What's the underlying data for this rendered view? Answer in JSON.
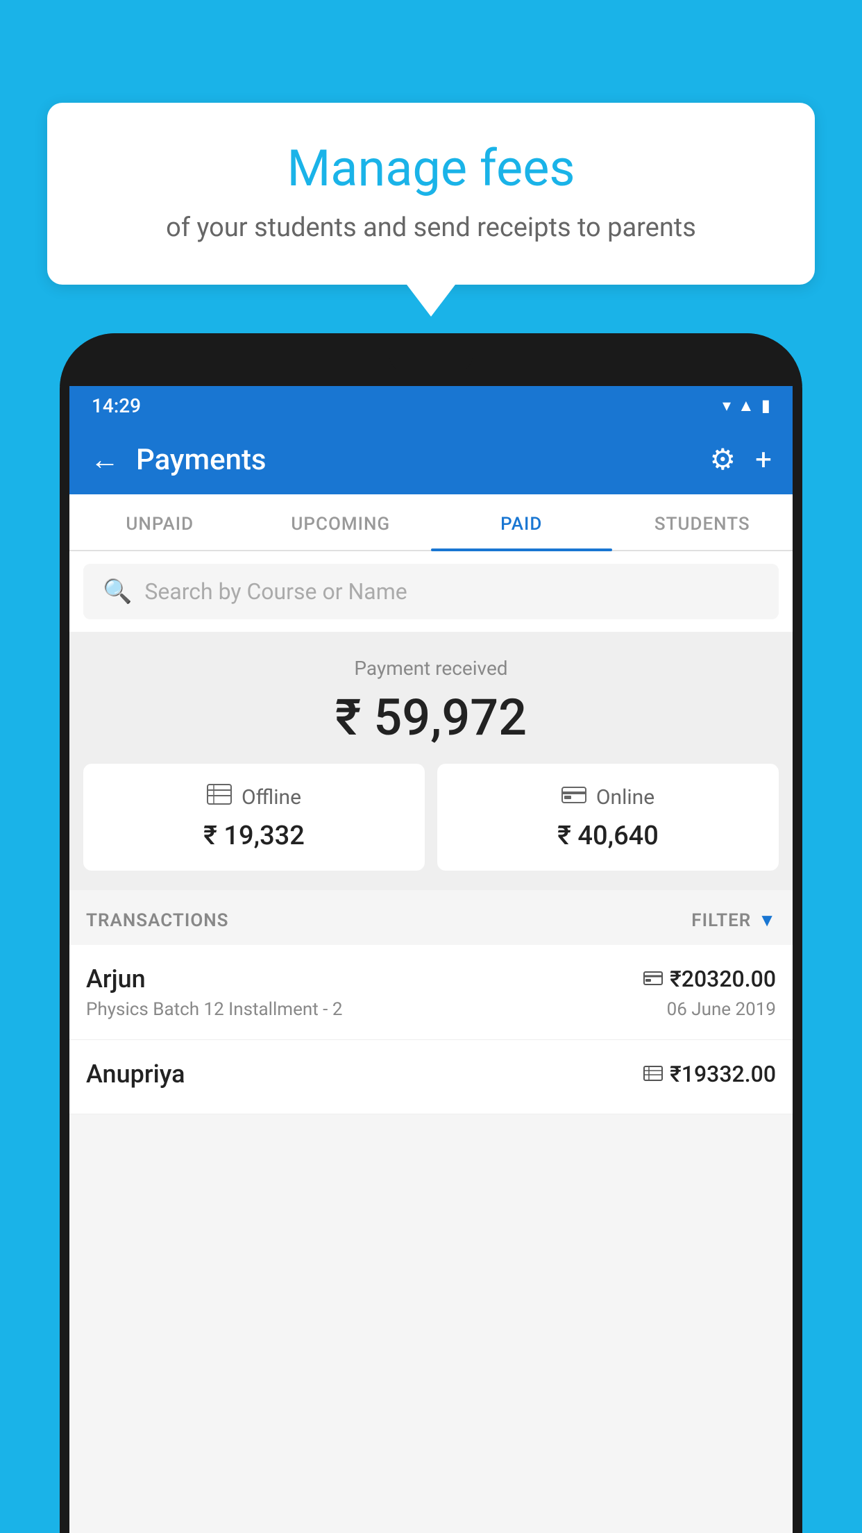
{
  "page": {
    "background_color": "#1ab3e8"
  },
  "tooltip": {
    "title": "Manage fees",
    "subtitle": "of your students and send receipts to parents"
  },
  "status_bar": {
    "time": "14:29",
    "icons": [
      "wifi",
      "signal",
      "battery"
    ]
  },
  "app_bar": {
    "title": "Payments",
    "back_label": "←",
    "gear_label": "⚙",
    "plus_label": "+"
  },
  "tabs": [
    {
      "label": "UNPAID",
      "active": false
    },
    {
      "label": "UPCOMING",
      "active": false
    },
    {
      "label": "PAID",
      "active": true
    },
    {
      "label": "STUDENTS",
      "active": false
    }
  ],
  "search": {
    "placeholder": "Search by Course or Name"
  },
  "payment_summary": {
    "label": "Payment received",
    "total": "₹ 59,972",
    "offline": {
      "type": "Offline",
      "amount": "₹ 19,332"
    },
    "online": {
      "type": "Online",
      "amount": "₹ 40,640"
    }
  },
  "transactions": {
    "header": "TRANSACTIONS",
    "filter_label": "FILTER",
    "items": [
      {
        "name": "Arjun",
        "course": "Physics Batch 12 Installment - 2",
        "amount": "₹20320.00",
        "date": "06 June 2019",
        "payment_type": "online"
      },
      {
        "name": "Anupriya",
        "course": "",
        "amount": "₹19332.00",
        "date": "",
        "payment_type": "offline"
      }
    ]
  }
}
